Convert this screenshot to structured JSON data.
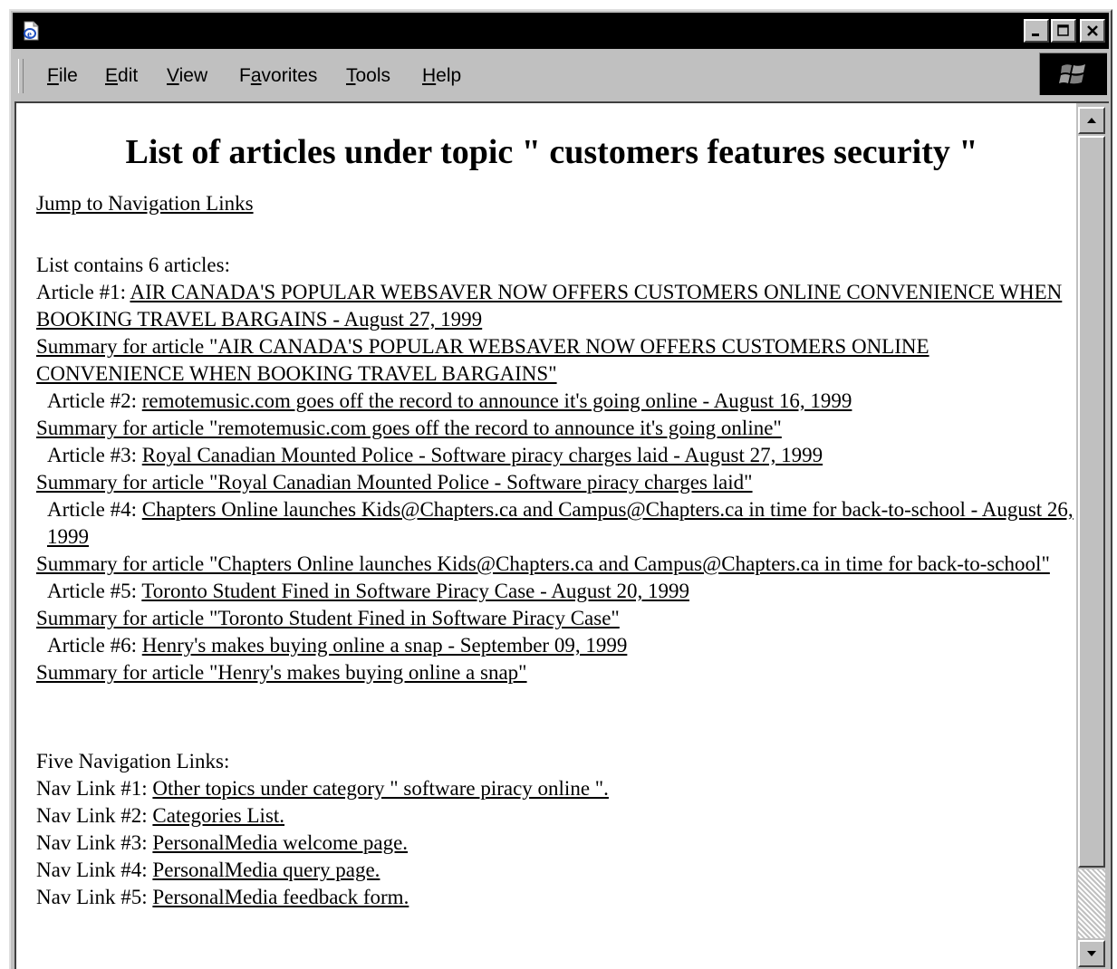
{
  "window": {
    "title": "",
    "controls": {
      "minimize": "_",
      "maximize": "□",
      "close": "×"
    }
  },
  "menu": {
    "items": [
      {
        "underline": "F",
        "rest": "ile"
      },
      {
        "underline": "E",
        "rest": "dit"
      },
      {
        "underline": "V",
        "rest": "iew"
      },
      {
        "pre": "F",
        "underline": "a",
        "rest": "vorites"
      },
      {
        "underline": "T",
        "rest": "ools"
      },
      {
        "underline": "H",
        "rest": "elp"
      }
    ]
  },
  "icons": {
    "app": "ie-page-icon",
    "throbber": "windows-logo-icon",
    "scroll_up": "arrow-up-icon",
    "scroll_down": "arrow-down-icon"
  },
  "page": {
    "title": "List of articles under topic \" customers features security \"",
    "jump_link": "Jump to Navigation Links",
    "list_intro": "List contains 6 articles:",
    "articles": [
      {
        "label": "Article #1:",
        "link": "AIR CANADA'S POPULAR WEBSAVER NOW OFFERS CUSTOMERS ONLINE CONVENIENCE WHEN BOOKING TRAVEL BARGAINS - August 27, 1999",
        "summary": "Summary for article \"AIR CANADA'S POPULAR WEBSAVER NOW OFFERS CUSTOMERS ONLINE CONVENIENCE WHEN BOOKING TRAVEL BARGAINS\""
      },
      {
        "label": "Article #2:",
        "link": "remotemusic.com goes off the record to announce it's going online - August 16, 1999",
        "summary": "Summary for article \"remotemusic.com goes off the record to announce it's going online\""
      },
      {
        "label": "Article #3:",
        "link": "Royal Canadian Mounted Police - Software piracy charges laid - August 27, 1999",
        "summary": "Summary for article \"Royal Canadian Mounted Police - Software piracy charges laid\""
      },
      {
        "label": "Article #4:",
        "link": "Chapters Online launches Kids@Chapters.ca and Campus@Chapters.ca in time for back-to-school - August 26, 1999",
        "summary": "Summary for article \"Chapters Online launches Kids@Chapters.ca and Campus@Chapters.ca in time for back-to-school\""
      },
      {
        "label": "Article #5:",
        "link": "Toronto Student Fined in Software Piracy Case - August 20, 1999",
        "summary": "Summary for article \"Toronto Student Fined in Software Piracy Case\""
      },
      {
        "label": "Article #6:",
        "link": "Henry's makes buying online a snap - September 09, 1999",
        "summary": "Summary for article \"Henry's makes buying online a snap\""
      }
    ],
    "nav_intro": "Five Navigation Links:",
    "nav_links": [
      {
        "label": "Nav Link #1:",
        "link": "Other topics under category \" software piracy online \"."
      },
      {
        "label": "Nav Link #2:",
        "link": "Categories List."
      },
      {
        "label": "Nav Link #3:",
        "link": "PersonalMedia welcome page."
      },
      {
        "label": "Nav Link #4:",
        "link": "PersonalMedia query page."
      },
      {
        "label": "Nav Link #5:",
        "link": "PersonalMedia feedback form."
      }
    ]
  },
  "colors": {
    "titlebar": "#000000",
    "chrome": "#c0c0c0",
    "page_background": "#ffffff",
    "text": "#000000"
  }
}
